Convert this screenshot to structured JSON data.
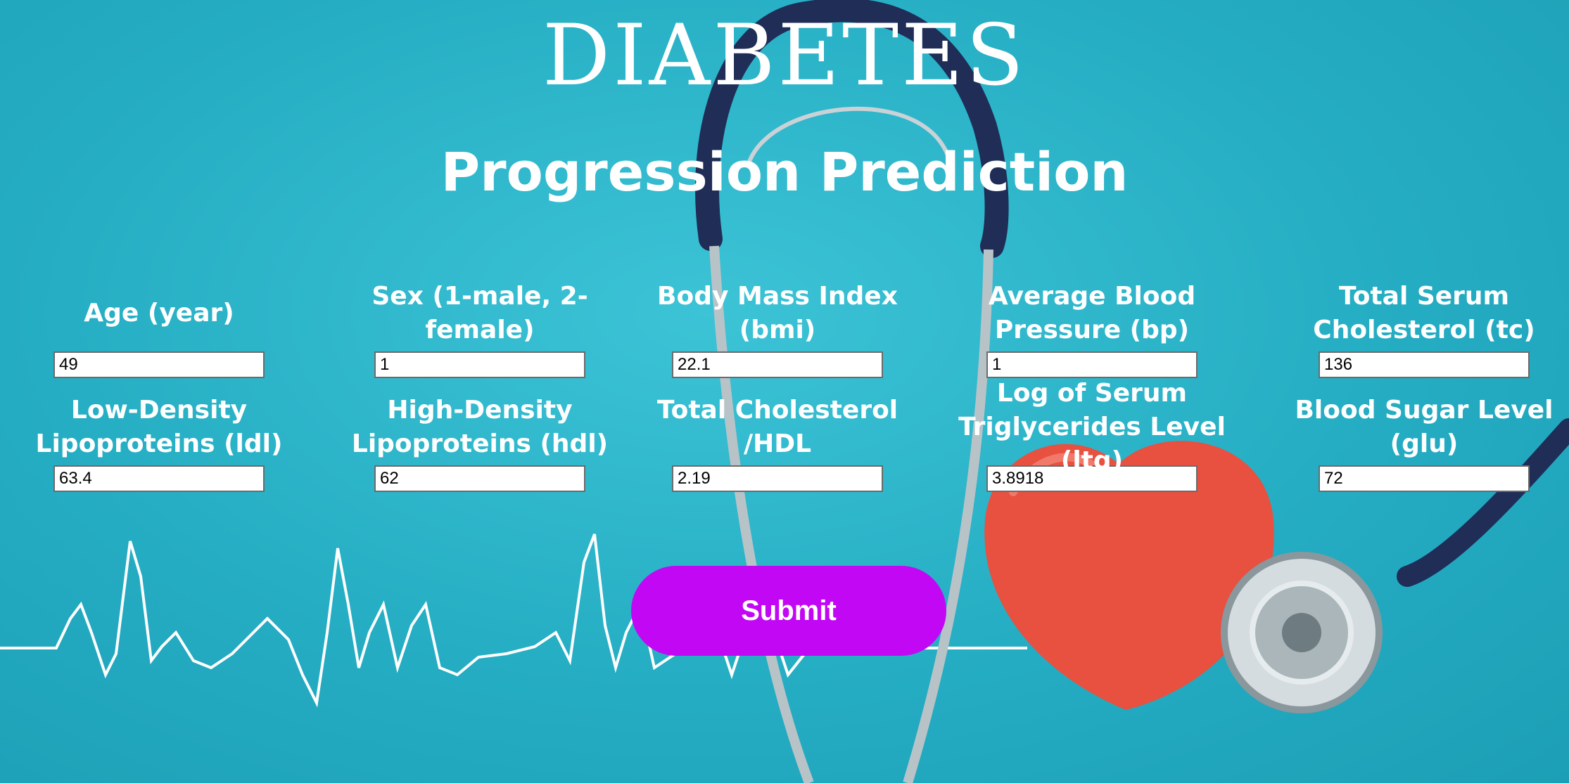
{
  "page": {
    "title": "DIABETES",
    "subtitle": "Progression Prediction"
  },
  "fields": [
    {
      "label": "Age (year)",
      "value": "49"
    },
    {
      "label": "Sex (1-male, 2-female)",
      "value": "1"
    },
    {
      "label": "Body Mass Index (bmi)",
      "value": "22.1"
    },
    {
      "label": "Average Blood Pressure (bp)",
      "value": "1"
    },
    {
      "label": "Total Serum Cholesterol (tc)",
      "value": "136"
    },
    {
      "label": "Low-Density Lipoproteins (ldl)",
      "value": "63.4"
    },
    {
      "label": "High-Density Lipoproteins (hdl)",
      "value": "62"
    },
    {
      "label": "Total Cholesterol /HDL",
      "value": "2.19"
    },
    {
      "label": "Log of Serum Triglycerides Level (ltg)",
      "value": "3.8918"
    },
    {
      "label": "Blood Sugar Level (glu)",
      "value": "72"
    }
  ],
  "submit_label": "Submit",
  "colors": {
    "background": "#2db4c9",
    "button": "#c207f5",
    "heart": "#e8503f",
    "stethoscope_tube": "#1f2d57"
  }
}
